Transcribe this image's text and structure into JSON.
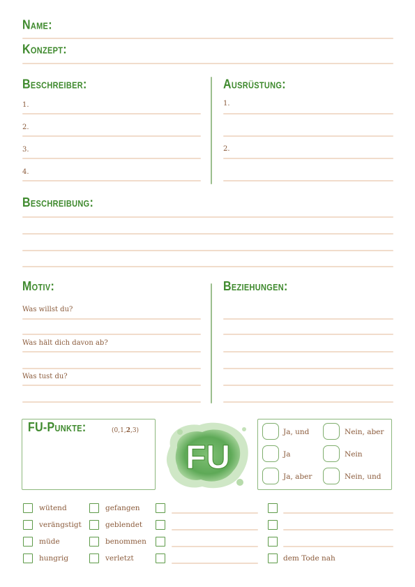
{
  "header": {
    "name_label": "Name:",
    "konzept_label": "Konzept:"
  },
  "beschreiber": {
    "title": "Beschreiber:",
    "items": [
      "1.",
      "2.",
      "3.",
      "4."
    ]
  },
  "ausruestung": {
    "title": "Ausrüstung:",
    "items": [
      "1.",
      "2."
    ]
  },
  "beschreibung": {
    "title": "Beschreibung:"
  },
  "motiv": {
    "title": "Motiv:",
    "prompts": [
      "Was willst du?",
      "Was hält dich davon ab?",
      "Was tust du?"
    ]
  },
  "beziehungen": {
    "title": "Beziehungen:"
  },
  "fu_punkte": {
    "title": "FU-Punkte:",
    "scale_prefix": "(0,1,",
    "scale_bold": "2",
    "scale_suffix": ",3)"
  },
  "logo": {
    "text": "FU",
    "color_dark": "#4f9a4a",
    "color_light": "#b9dcae"
  },
  "oracle": {
    "answers": [
      "Ja, und",
      "Nein, aber",
      "Ja",
      "Nein",
      "Ja, aber",
      "Nein, und"
    ]
  },
  "conditions": {
    "col1": [
      "wütend",
      "verängstigt",
      "müde",
      "hungrig"
    ],
    "col2": [
      "gefangen",
      "geblendet",
      "benommen",
      "verletzt"
    ],
    "col4_last": "dem Tode nah"
  },
  "colors": {
    "heading": "#3f8a2e",
    "line": "#f1dccb",
    "text": "#8a5a3a",
    "box_border": "#8cb77c"
  }
}
